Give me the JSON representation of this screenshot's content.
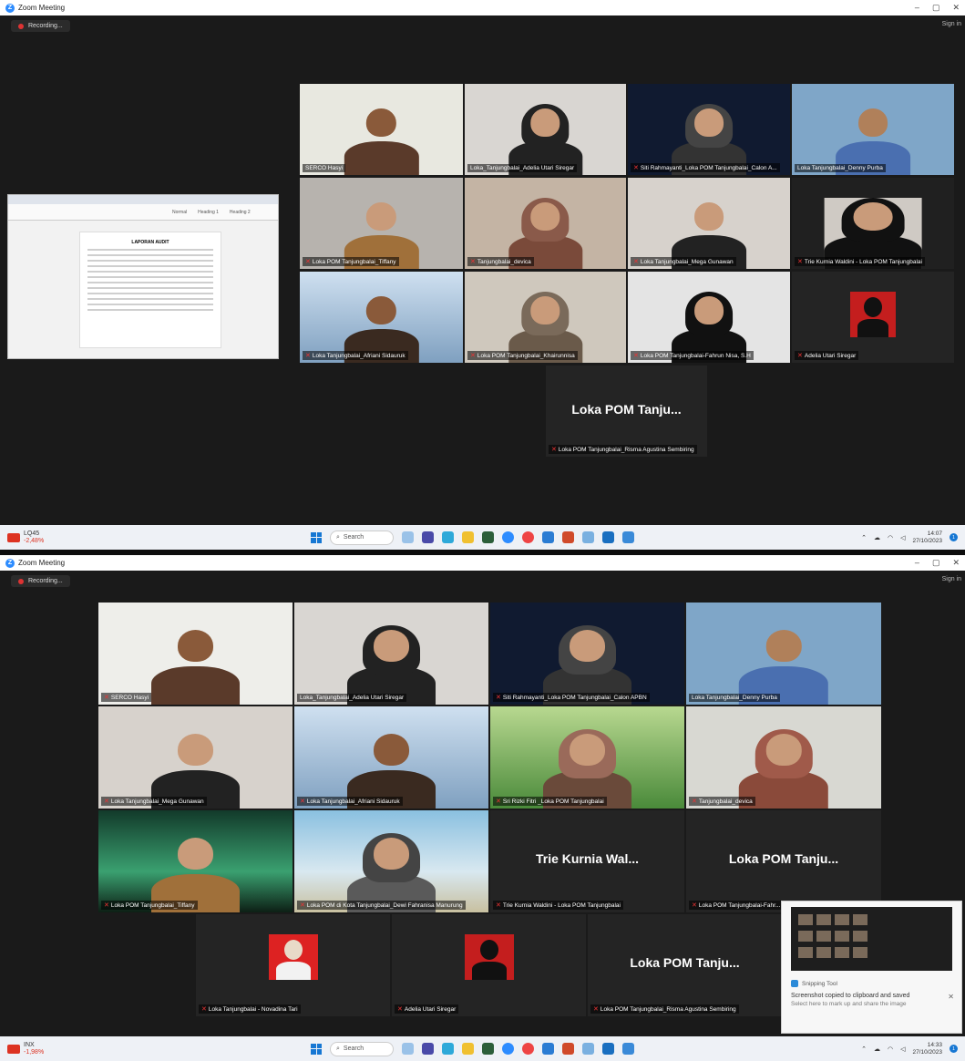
{
  "app": {
    "title": "Zoom Meeting",
    "recording_label": "Recording...",
    "sign_in_label": "Sign in"
  },
  "screen_top": {
    "tiles": [
      {
        "name": "SERCO Hasyi"
      },
      {
        "name": "Loka_Tanjungbalai_Adelia Utari Siregar"
      },
      {
        "name": "Siti Rahmayanti_Loka POM Tanjungbalai_Calon A..."
      },
      {
        "name": "Loka Tanjungbalai_Denny Purba"
      },
      {
        "name": "Loka POM Tanjungbalai_Tiffany"
      },
      {
        "name": "Tanjungbalai_devica"
      },
      {
        "name": "Loka Tanjungbalai_Mega Gunawan"
      },
      {
        "name": "Trie Kurnia Waldini - Loka POM Tanjungbalai"
      },
      {
        "name": "Loka Tanjungbalai_Afriani Sidauruk"
      },
      {
        "name": "Loka POM Tanjungbalai_Khairunnisa"
      },
      {
        "name": "Loka POM Tanjungbalai-Fahrun Nisa, S.H"
      },
      {
        "name": "Adelia Utari Siregar"
      },
      {
        "name": "Loka POM Tanjungbalai_Risma Agustina Sembiring",
        "big": "Loka POM Tanju..."
      }
    ],
    "shared_doc": {
      "title": "LAPORAN AUDIT",
      "heading1": "Heading 1",
      "heading2": "Heading 2",
      "normal": "Normal"
    },
    "taskbar": {
      "stock_name": "LQ45",
      "stock_change": "-2,48%",
      "search": "Search",
      "time": "14:07",
      "date": "27/10/2023"
    }
  },
  "screen_bottom": {
    "tiles": [
      {
        "name": "SERCO Hasyi"
      },
      {
        "name": "Loka_Tanjungbalai_Adelia Utari Siregar"
      },
      {
        "name": "Siti Rahmayanti_Loka POM Tanjungbalai_Calon APBN"
      },
      {
        "name": "Loka Tanjungbalai_Denny Purba"
      },
      {
        "name": "Loka Tanjungbalai_Mega Gunawan"
      },
      {
        "name": "Loka Tanjungbalai_Afriani Sidauruk"
      },
      {
        "name": "Sri Rizki Fitri _Loka POM Tanjungbalai"
      },
      {
        "name": "Tanjungbalai_devica"
      },
      {
        "name": "Loka POM Tanjungbalai_Tiffany"
      },
      {
        "name": "Loka POM di Kota Tanjungbalai_Dewi Fahranisa Manurung"
      },
      {
        "name": "Trie Kurnia Waldini - Loka POM Tanjungbalai",
        "big": "Trie Kurnia Wal..."
      },
      {
        "name": "Loka POM Tanjungbalai-Fahr...",
        "big": "Loka POM Tanju..."
      },
      {
        "name": "Loka Tanjungbalai - Novadina Tari"
      },
      {
        "name": "Adelia Utari Siregar"
      },
      {
        "name": "Loka POM Tanjungbalai_Risma Agustina Sembiring",
        "big": "Loka POM Tanju..."
      }
    ],
    "snipping": {
      "app": "Snipping Tool",
      "message": "Screenshot copied to clipboard and saved",
      "sub": "Select here to mark up and share the image"
    },
    "taskbar": {
      "stock_name": "INX",
      "stock_change": "-1,98%",
      "search": "Search",
      "time": "14:33",
      "date": "27/10/2023"
    }
  },
  "colors": {
    "active_speaker": "#d7e85a",
    "mic_muted": "#e33333",
    "accent": "#2d8cff"
  }
}
